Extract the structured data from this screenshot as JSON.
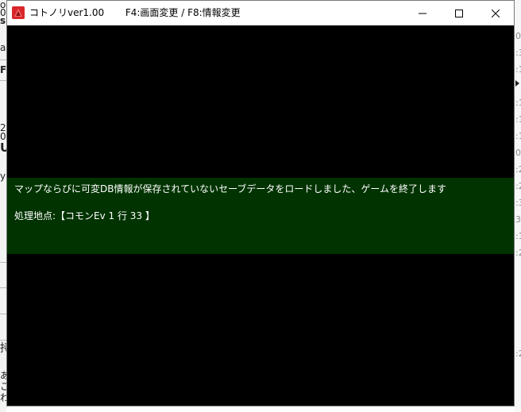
{
  "window": {
    "app_title": "コトノリver1.00",
    "hint": "F4:画面変更 / F8:情報変更",
    "controls": {
      "minimize": "minimize-icon",
      "maximize": "maximize-icon",
      "close": "close-icon"
    }
  },
  "message": {
    "line1": "マップならびに可変DB情報が保存されていないセーブデータをロードしました、ゲームを終了します",
    "line2": "処理地点:【コモンEv 1 行 33 】"
  },
  "colors": {
    "message_bg": "#003300",
    "game_bg": "#000000",
    "icon_red": "#d9262a"
  },
  "background_fragments": {
    "left": [
      "o",
      "0",
      "sl",
      "a",
      "F",
      "20",
      "0",
      "U",
      "y",
      "持",
      "あ",
      "こ",
      "わ"
    ],
    "right": [
      "01",
      ":3",
      ":1",
      ":1",
      ":1",
      ":1",
      "03",
      ":2",
      ":2",
      ":3",
      "38",
      ":1",
      ":2",
      ":2"
    ]
  }
}
